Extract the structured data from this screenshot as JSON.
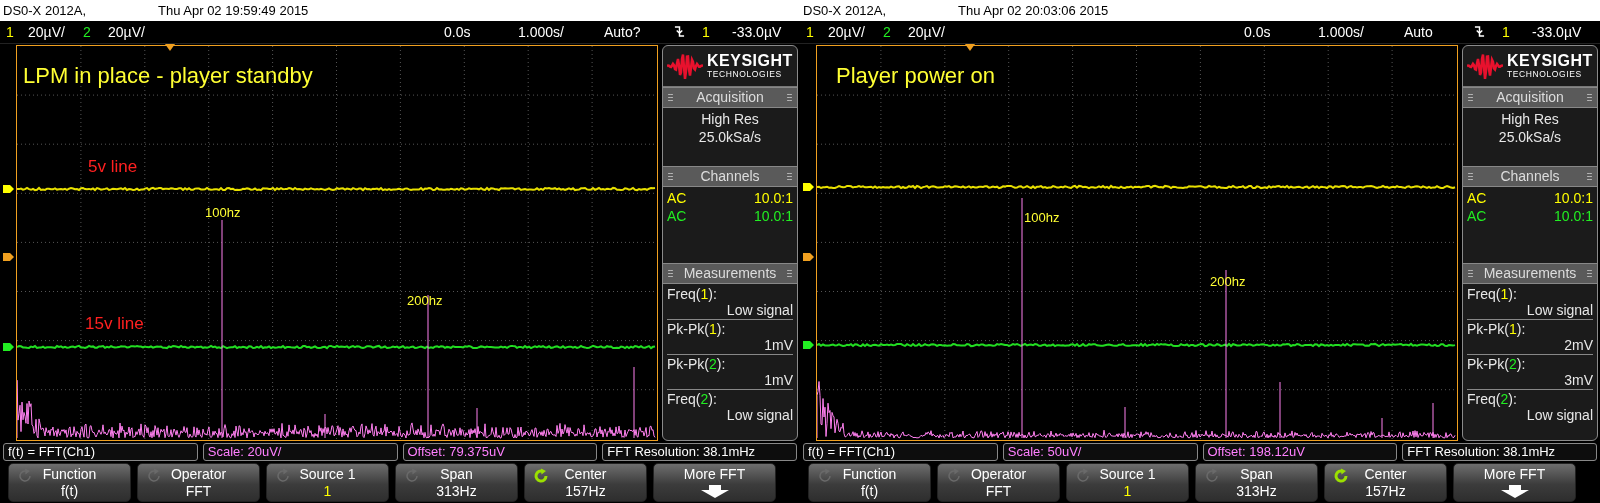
{
  "screens": [
    {
      "header": {
        "model": "DS0-X 2012A,",
        "datetime": "Thu Apr 02 19:59:49 2015"
      },
      "status_bar": {
        "channels": [
          {
            "number": "1",
            "scale": "20µV/",
            "color": "#ffff00"
          },
          {
            "number": "2",
            "scale": "20µV/",
            "color": "#22ee22"
          }
        ],
        "delay": "0.0s",
        "timebase": "1.000s/",
        "trigger_mode": "Auto?",
        "trigger_source": "1",
        "trigger_level": "-33.0µV"
      },
      "annotations": [
        {
          "kind": "title",
          "text": "LPM in place - player standby",
          "color": "#ffff33"
        },
        {
          "kind": "trace_label",
          "text": "5v line",
          "color": "#ff2020"
        },
        {
          "kind": "peak_label",
          "text": "100hz",
          "color": "#ffff33"
        },
        {
          "kind": "peak_label",
          "text": "200hz",
          "color": "#ffff33"
        },
        {
          "kind": "trace_label",
          "text": "15v line",
          "color": "#ff2020"
        }
      ],
      "side_panel": {
        "logo": {
          "name": "KEYSIGHT",
          "tagline": "TECHNOLOGIES"
        },
        "acquisition": {
          "title": "Acquisition",
          "mode": "High Res",
          "rate": "25.0kSa/s"
        },
        "channels": {
          "title": "Channels",
          "rows": [
            {
              "coupling": "AC",
              "probe": "10.0:1",
              "color": "#ffff00"
            },
            {
              "coupling": "AC",
              "probe": "10.0:1",
              "color": "#22ee22"
            }
          ]
        },
        "measurements": {
          "title": "Measurements",
          "items": [
            {
              "prefix": "Freq(",
              "channel": "1",
              "suffix": "):",
              "color": "#ffff00",
              "value": "Low signal"
            },
            {
              "prefix": "Pk-Pk(",
              "channel": "1",
              "suffix": "):",
              "color": "#ffff00",
              "value": "1mV"
            },
            {
              "prefix": "Pk-Pk(",
              "channel": "2",
              "suffix": "):",
              "color": "#22ee22",
              "value": "1mV"
            },
            {
              "prefix": "Freq(",
              "channel": "2",
              "suffix": "):",
              "color": "#22ee22",
              "value": "Low signal"
            }
          ]
        }
      },
      "info_bar": [
        {
          "text": "f(t) = FFT(Ch1)",
          "color": "#ffffff"
        },
        {
          "text": "Scale: 20uV/",
          "color": "#ff80ff"
        },
        {
          "text": "Offset: 79.375uV",
          "color": "#ff80ff"
        },
        {
          "text": "FFT Resolution: 38.1mHz",
          "color": "#ffffff"
        }
      ],
      "softkeys": [
        {
          "kind": "knob",
          "label": "Function",
          "value": "f(t)",
          "active": false,
          "color": "#ffffff"
        },
        {
          "kind": "knob",
          "label": "Operator",
          "value": "FFT",
          "active": false,
          "color": "#ffffff"
        },
        {
          "kind": "knob",
          "label": "Source 1",
          "value": "1",
          "active": false,
          "color": "#ffff00"
        },
        {
          "kind": "knob",
          "label": "Span",
          "value": "313Hz",
          "active": false,
          "color": "#ffffff"
        },
        {
          "kind": "knob",
          "label": "Center",
          "value": "157Hz",
          "active": true,
          "color": "#ffffff"
        },
        {
          "kind": "menu",
          "label": "More FFT"
        }
      ]
    },
    {
      "header": {
        "model": "DS0-X 2012A,",
        "datetime": "Thu Apr 02 20:03:06 2015"
      },
      "status_bar": {
        "channels": [
          {
            "number": "1",
            "scale": "20µV/",
            "color": "#ffff00"
          },
          {
            "number": "2",
            "scale": "20µV/",
            "color": "#22ee22"
          }
        ],
        "delay": "0.0s",
        "timebase": "1.000s/",
        "trigger_mode": "Auto",
        "trigger_source": "1",
        "trigger_level": "-33.0µV"
      },
      "annotations": [
        {
          "kind": "title",
          "text": "Player power on",
          "color": "#ffff33"
        },
        {
          "kind": "peak_label",
          "text": "100hz",
          "color": "#ffff33"
        },
        {
          "kind": "peak_label",
          "text": "200hz",
          "color": "#ffff33"
        }
      ],
      "side_panel": {
        "logo": {
          "name": "KEYSIGHT",
          "tagline": "TECHNOLOGIES"
        },
        "acquisition": {
          "title": "Acquisition",
          "mode": "High Res",
          "rate": "25.0kSa/s"
        },
        "channels": {
          "title": "Channels",
          "rows": [
            {
              "coupling": "AC",
              "probe": "10.0:1",
              "color": "#ffff00"
            },
            {
              "coupling": "AC",
              "probe": "10.0:1",
              "color": "#22ee22"
            }
          ]
        },
        "measurements": {
          "title": "Measurements",
          "items": [
            {
              "prefix": "Freq(",
              "channel": "1",
              "suffix": "):",
              "color": "#ffff00",
              "value": "Low signal"
            },
            {
              "prefix": "Pk-Pk(",
              "channel": "1",
              "suffix": "):",
              "color": "#ffff00",
              "value": "2mV"
            },
            {
              "prefix": "Pk-Pk(",
              "channel": "2",
              "suffix": "):",
              "color": "#22ee22",
              "value": "3mV"
            },
            {
              "prefix": "Freq(",
              "channel": "2",
              "suffix": "):",
              "color": "#22ee22",
              "value": "Low signal"
            }
          ]
        }
      },
      "info_bar": [
        {
          "text": "f(t) = FFT(Ch1)",
          "color": "#ffffff"
        },
        {
          "text": "Scale: 50uV/",
          "color": "#ff80ff"
        },
        {
          "text": "Offset: 198.12uV",
          "color": "#ff80ff"
        },
        {
          "text": "FFT Resolution: 38.1mHz",
          "color": "#ffffff"
        }
      ],
      "softkeys": [
        {
          "kind": "knob",
          "label": "Function",
          "value": "f(t)",
          "active": false,
          "color": "#ffffff"
        },
        {
          "kind": "knob",
          "label": "Operator",
          "value": "FFT",
          "active": false,
          "color": "#ffffff"
        },
        {
          "kind": "knob",
          "label": "Source 1",
          "value": "1",
          "active": false,
          "color": "#ffff00"
        },
        {
          "kind": "knob",
          "label": "Span",
          "value": "313Hz",
          "active": false,
          "color": "#ffffff"
        },
        {
          "kind": "knob",
          "label": "Center",
          "value": "157Hz",
          "active": true,
          "color": "#ffffff"
        },
        {
          "kind": "menu",
          "label": "More FFT"
        }
      ]
    }
  ]
}
